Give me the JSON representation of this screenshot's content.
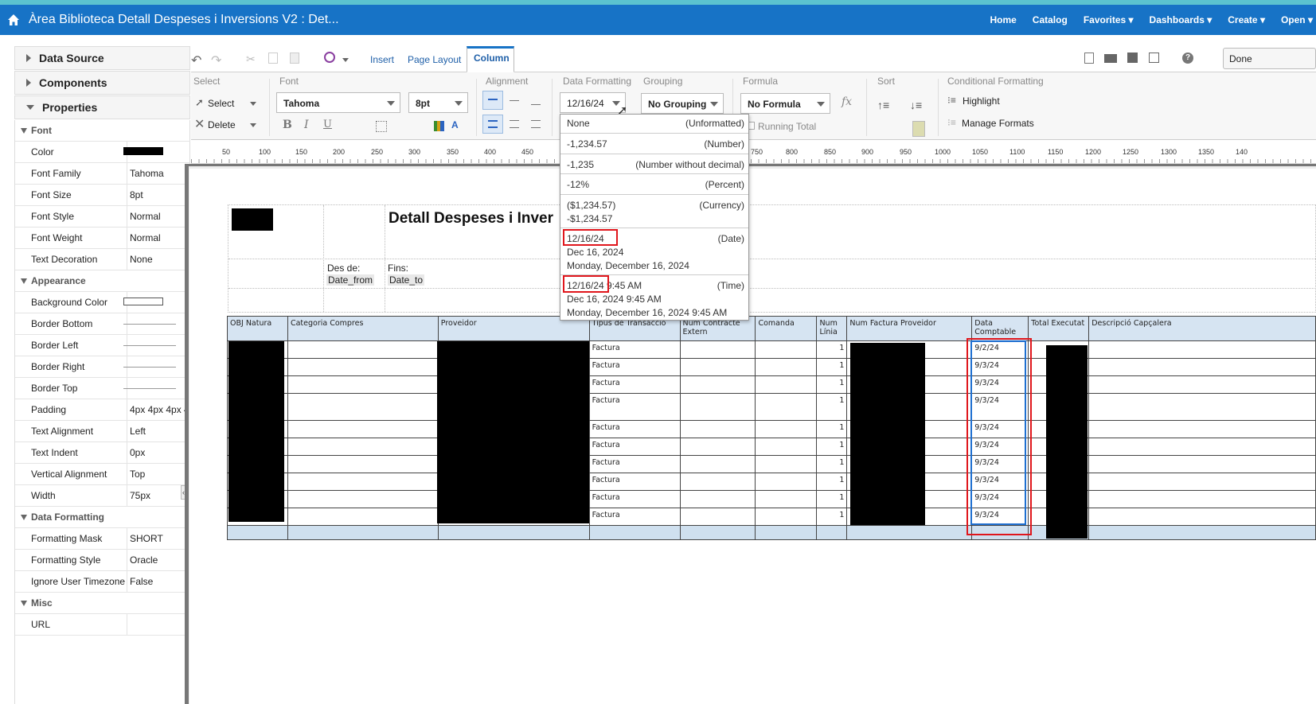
{
  "app": {
    "title": "Àrea Biblioteca Detall Despeses i Inversions V2 : Det...",
    "nav": [
      "Home",
      "Catalog",
      "Favorites ▾",
      "Dashboards ▾",
      "Create ▾",
      "Open ▾"
    ]
  },
  "left": {
    "sections": [
      "Data Source",
      "Components",
      "Properties"
    ],
    "groups": {
      "font": "Font",
      "appearance": "Appearance",
      "data_formatting": "Data Formatting",
      "misc": "Misc"
    },
    "font_props": [
      {
        "k": "Color",
        "v": ""
      },
      {
        "k": "Font Family",
        "v": "Tahoma"
      },
      {
        "k": "Font Size",
        "v": "8pt"
      },
      {
        "k": "Font Style",
        "v": "Normal"
      },
      {
        "k": "Font Weight",
        "v": "Normal"
      },
      {
        "k": "Text Decoration",
        "v": "None"
      }
    ],
    "appearance_props": [
      {
        "k": "Background Color",
        "v": ""
      },
      {
        "k": "Border Bottom",
        "v": ""
      },
      {
        "k": "Border Left",
        "v": ""
      },
      {
        "k": "Border Right",
        "v": ""
      },
      {
        "k": "Border Top",
        "v": ""
      },
      {
        "k": "Padding",
        "v": "4px 4px 4px 4"
      },
      {
        "k": "Text Alignment",
        "v": "Left"
      },
      {
        "k": "Text Indent",
        "v": "0px"
      },
      {
        "k": "Vertical Alignment",
        "v": "Top"
      },
      {
        "k": "Width",
        "v": "75px"
      }
    ],
    "format_props": [
      {
        "k": "Formatting Mask",
        "v": "SHORT"
      },
      {
        "k": "Formatting Style",
        "v": "Oracle"
      },
      {
        "k": "Ignore User Timezone",
        "v": "False"
      }
    ],
    "misc_props": [
      {
        "k": "URL",
        "v": ""
      }
    ]
  },
  "toolbar": {
    "tabs": [
      "Insert",
      "Page Layout",
      "Column"
    ],
    "done": "Done"
  },
  "ribbon": {
    "select_label": "Select",
    "select": "Select",
    "delete": "Delete",
    "font_label": "Font",
    "font_family": "Tahoma",
    "font_size": "8pt",
    "alignment_label": "Alignment",
    "data_formatting_label": "Data Formatting",
    "data_format_value": "12/16/24",
    "grouping_label": "Grouping",
    "grouping_value": "No Grouping",
    "formula_label": "Formula",
    "formula_value": "No Formula",
    "running_total": "Running Total",
    "sort_label": "Sort",
    "conditional_label": "Conditional Formatting",
    "highlight": "Highlight",
    "manage_formats": "Manage Formats"
  },
  "ruler": [
    "50",
    "100",
    "150",
    "200",
    "250",
    "300",
    "350",
    "400",
    "450",
    "750",
    "800",
    "850",
    "900",
    "950",
    "1000",
    "1050",
    "1100",
    "1150",
    "1200",
    "1250",
    "1300",
    "1350",
    "140"
  ],
  "report": {
    "title": "Detall Despeses i Inver",
    "des_de": "Des de:",
    "date_from": "Date_from",
    "fins": "Fins:",
    "date_to": "Date_to",
    "columns": [
      "OBJ Natura",
      "Categoria Compres",
      "Proveidor",
      "Tipus de Transacció",
      "Num Contracte Extern",
      "Comanda",
      "Num Línia",
      "Num Factura Proveidor",
      "Data Comptable",
      "Total Executat",
      "Descripció Capçalera"
    ],
    "rows": [
      {
        "tipus": "Factura",
        "linia": "1",
        "data": "9/2/24"
      },
      {
        "tipus": "Factura",
        "linia": "1",
        "data": "9/3/24"
      },
      {
        "tipus": "Factura",
        "linia": "1",
        "data": "9/3/24"
      },
      {
        "tipus": "Factura",
        "linia": "1",
        "data": "9/3/24"
      },
      {
        "tipus": "Factura",
        "linia": "1",
        "data": "9/3/24"
      },
      {
        "tipus": "Factura",
        "linia": "1",
        "data": "9/3/24"
      },
      {
        "tipus": "Factura",
        "linia": "1",
        "data": "9/3/24"
      },
      {
        "tipus": "Factura",
        "linia": "1",
        "data": "9/3/24"
      },
      {
        "tipus": "Factura",
        "linia": "1",
        "data": "9/3/24"
      },
      {
        "tipus": "Factura",
        "linia": "1",
        "data": "9/3/24"
      }
    ]
  },
  "dropdown": {
    "none": "None",
    "unformatted": "(Unformatted)",
    "num1": "-1,234.57",
    "number": "(Number)",
    "num2": "-1,235",
    "number_nd": "(Number without decimal)",
    "pct": "-12%",
    "percent": "(Percent)",
    "cur1": "($1,234.57)",
    "cur2": "-$1,234.57",
    "currency": "(Currency)",
    "date1": "12/16/24",
    "date2": "Dec 16, 2024",
    "date3": "Monday, December 16, 2024",
    "date": "(Date)",
    "time1": "12/16/24 9:45 AM",
    "time2": "Dec 16, 2024 9:45 AM",
    "time3": "Monday, December 16, 2024 9:45 AM",
    "time": "(Time)"
  },
  "colors": {
    "appbar": "#1773c6",
    "strip": "#5bc3cf",
    "header_fill": "#d6e4f2",
    "highlight_red": "#e0161c",
    "select_blue": "#1e6fd0"
  }
}
